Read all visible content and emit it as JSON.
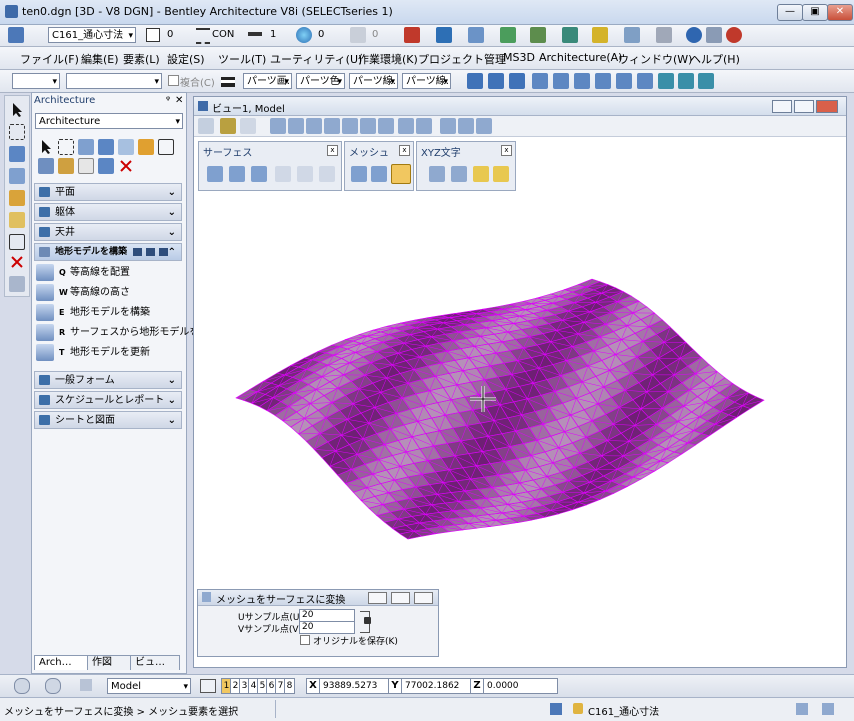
{
  "window": {
    "title": "ten0.dgn [3D - V8 DGN] - Bentley Architecture V8i (SELECTseries 1)",
    "btn_min": "—",
    "btn_max": "▣",
    "btn_close": "✕"
  },
  "toolbar1": {
    "textstyle": "C161_通心寸法",
    "color_value": "0",
    "linestyle": "CON",
    "weight": "1",
    "level_value": "0",
    "transp_value": "0"
  },
  "menu": [
    "ファイル(F)",
    "編集(E)",
    "要素(L)",
    "設定(S)",
    "ツール(T)",
    "ユーティリティ(U)",
    "作業環境(K)",
    "プロジェクト管理",
    "MS3D",
    "Architecture(A)",
    "ウィンドウ(W)",
    "ヘルプ(H)"
  ],
  "toolbar3": {
    "check_label": "複合(C)",
    "parts": [
      "パーツ画...",
      "パーツ色",
      "パーツ線...",
      "パーツ線..."
    ]
  },
  "panel": {
    "title": "Architecture",
    "close": "✕",
    "pin": "ᵠ",
    "dropdown": "Architecture",
    "sections_top": [
      {
        "label": "平面"
      },
      {
        "label": "躯体"
      },
      {
        "label": "天井"
      }
    ],
    "active_section": "地形モデルを構築",
    "tasks": [
      {
        "key": "Q",
        "label": "等高線を配置"
      },
      {
        "key": "W",
        "label": "等高線の高さ"
      },
      {
        "key": "E",
        "label": "地形モデルを構築"
      },
      {
        "key": "R",
        "label": "サーフェスから地形モデルを…"
      },
      {
        "key": "T",
        "label": "地形モデルを更新"
      }
    ],
    "sections_bottom": [
      {
        "label": "一般フォーム"
      },
      {
        "label": "スケジュールとレポート"
      },
      {
        "label": "シートと図面"
      }
    ],
    "tabs": [
      "Arch…",
      "作図",
      "ビュ…"
    ]
  },
  "view": {
    "title": "ビュー1, Model"
  },
  "toolboxes": [
    {
      "title": "サーフェス",
      "close": "x"
    },
    {
      "title": "メッシュ",
      "close": "x"
    },
    {
      "title": "XYZ文字",
      "close": "x"
    }
  ],
  "dialog": {
    "title": "メッシュをサーフェスに変換",
    "u_label": "Uサンプル点(U):",
    "u_value": "20",
    "v_label": "Vサンプル点(V):",
    "v_value": "20",
    "keep_label": "オリジナルを保存(K)"
  },
  "statusbar": {
    "model": "Model",
    "views": [
      "1",
      "2",
      "3",
      "4",
      "5",
      "6",
      "7",
      "8"
    ],
    "x_label": "X",
    "x_value": "93889.5273",
    "y_label": "Y",
    "y_value": "77002.1862",
    "z_label": "Z",
    "z_value": "0.0000"
  },
  "prompt": {
    "text": "メッシュをサーフェスに変換 > メッシュ要素を選択",
    "textstyle": "C161_通心寸法"
  },
  "colors": {
    "mesh": "#e000ff",
    "surface": "#6e1f74"
  }
}
